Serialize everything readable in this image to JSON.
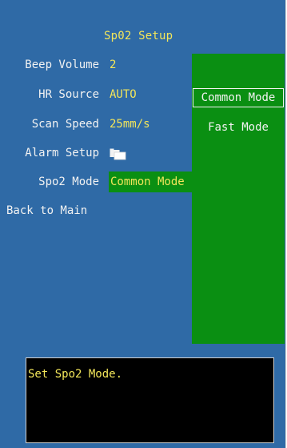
{
  "app": {
    "title": "Sp02 Setup"
  },
  "menu": {
    "items": [
      {
        "label": "Beep Volume",
        "value": "2"
      },
      {
        "label": "HR Source",
        "value": "AUTO"
      },
      {
        "label": "Scan Speed",
        "value": "25mm/s"
      },
      {
        "label": "Alarm Setup",
        "icon": "folder-icon"
      },
      {
        "label": "Spo2  Mode",
        "value": "Common Mode"
      },
      {
        "label": "Back to Main"
      }
    ]
  },
  "dropdown": {
    "options": [
      "Common Mode",
      "Fast Mode"
    ],
    "selected": "Common Mode"
  },
  "info": {
    "text": "Set Spo2 Mode."
  },
  "colors": {
    "background": "#2f6aa6",
    "highlight": "#0a8f12",
    "value_text": "#f3e65a",
    "label_text": "#f2f2f2",
    "info_background": "#000000"
  }
}
